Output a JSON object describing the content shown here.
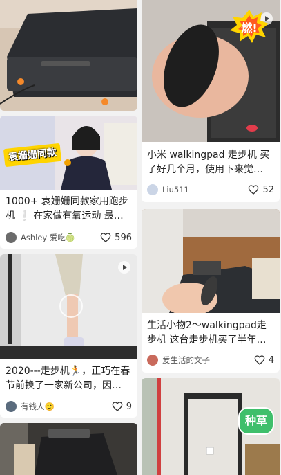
{
  "feed": [
    {
      "caption": "1000+ 袁姗姗同款家用跑步机 ❕ 在家做有氧运动 最…",
      "overlay_text": "袁姗姗同款",
      "author": "Ashley 爱吃🍈",
      "likes": "596"
    },
    {
      "caption": "小米 walkingpad 走步机 买了好几个月，使用下来觉…",
      "sticker": "燃!",
      "author": "Liu511",
      "likes": "52"
    },
    {
      "caption": "2020---走步机🏃，正巧在春节前换了一家新公司，因…",
      "author": "有钱人🙂",
      "likes": "9"
    },
    {
      "caption": "生活小物2～walkingpad走步机 这台走步机买了半年…",
      "author": "爱生活的文子",
      "likes": "4"
    },
    {
      "sticker": "种草"
    }
  ],
  "colors": {
    "heart_stroke": "#333333",
    "sticker_yellow": "#ffd400",
    "sticker_green": "#3fbf6b"
  }
}
